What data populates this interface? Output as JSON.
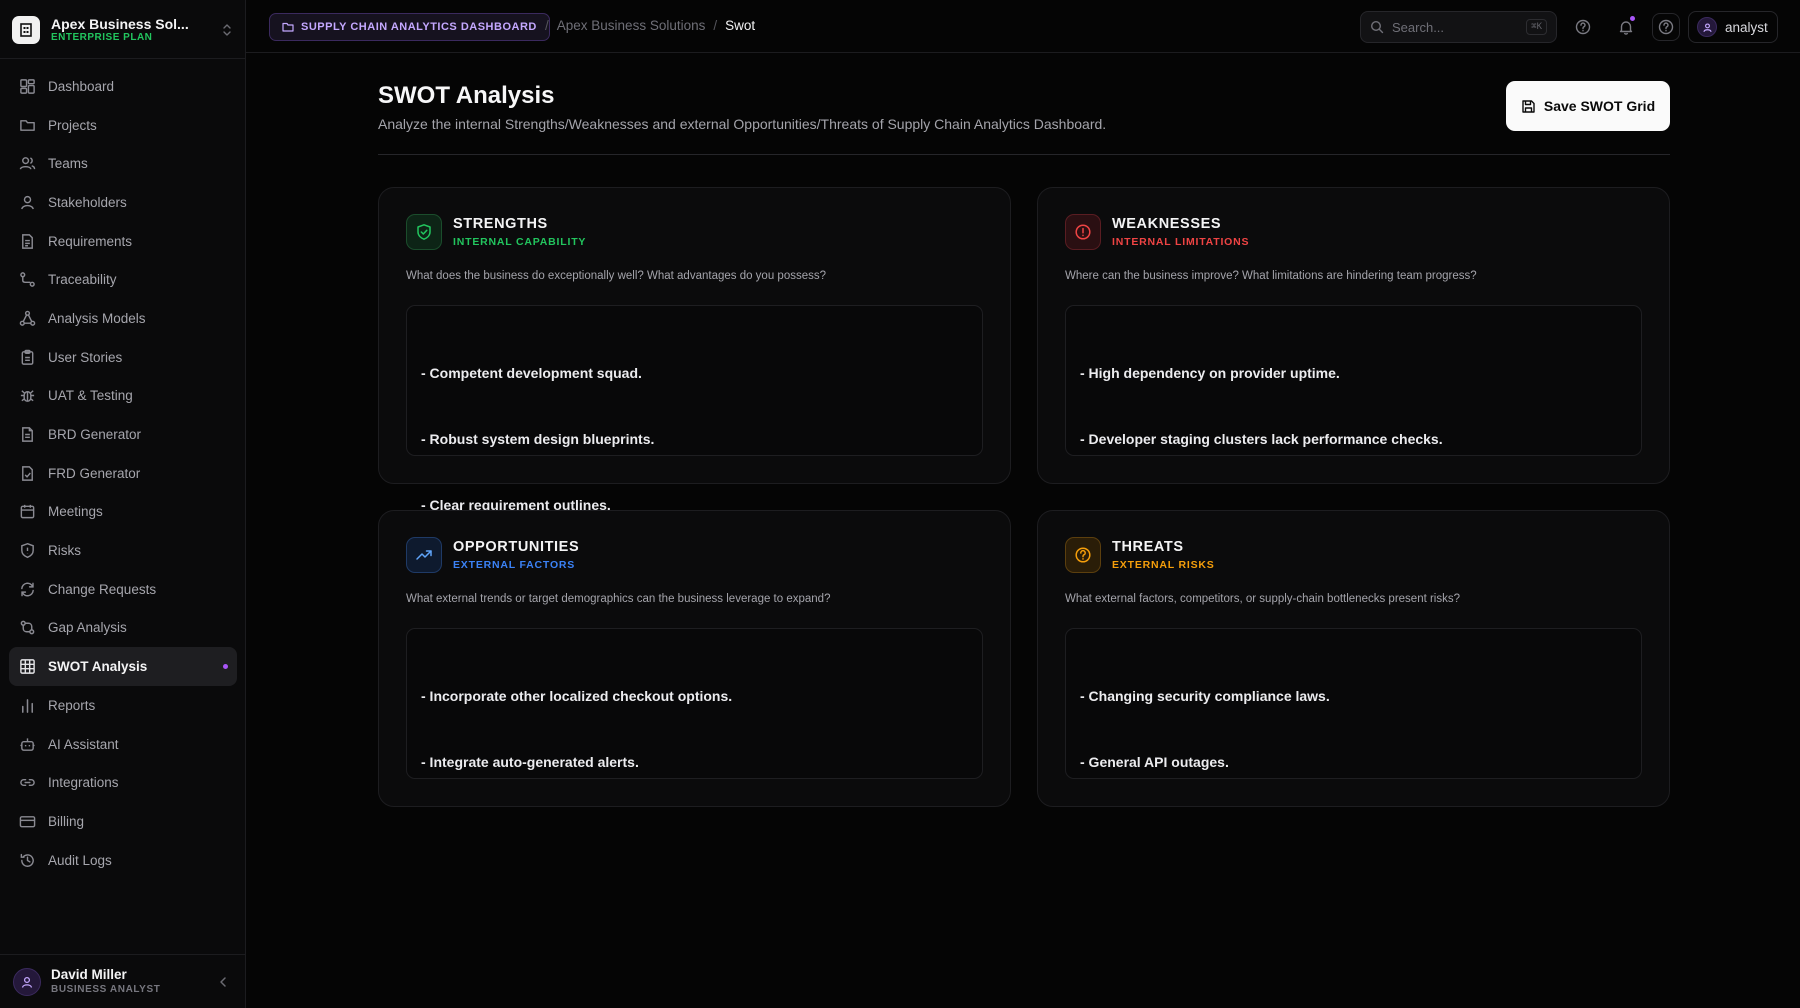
{
  "workspace": {
    "name": "Apex Business Sol...",
    "plan": "ENTERPRISE PLAN"
  },
  "sidebar": {
    "items": [
      {
        "label": "Dashboard",
        "icon": "grid-icon"
      },
      {
        "label": "Projects",
        "icon": "folder-icon"
      },
      {
        "label": "Teams",
        "icon": "users-icon"
      },
      {
        "label": "Stakeholders",
        "icon": "user-icon"
      },
      {
        "label": "Requirements",
        "icon": "file-text-icon"
      },
      {
        "label": "Traceability",
        "icon": "route-icon"
      },
      {
        "label": "Analysis Models",
        "icon": "network-icon"
      },
      {
        "label": "User Stories",
        "icon": "clipboard-icon"
      },
      {
        "label": "UAT & Testing",
        "icon": "bug-icon"
      },
      {
        "label": "BRD Generator",
        "icon": "file-icon"
      },
      {
        "label": "FRD Generator",
        "icon": "file-check-icon"
      },
      {
        "label": "Meetings",
        "icon": "calendar-icon"
      },
      {
        "label": "Risks",
        "icon": "shield-alert-icon"
      },
      {
        "label": "Change Requests",
        "icon": "refresh-icon"
      },
      {
        "label": "Gap Analysis",
        "icon": "git-compare-icon"
      },
      {
        "label": "SWOT Analysis",
        "icon": "table-grid-icon",
        "active": true
      },
      {
        "label": "Reports",
        "icon": "bar-chart-icon"
      },
      {
        "label": "AI Assistant",
        "icon": "bot-icon"
      },
      {
        "label": "Integrations",
        "icon": "link-icon"
      },
      {
        "label": "Billing",
        "icon": "credit-card-icon"
      },
      {
        "label": "Audit Logs",
        "icon": "history-icon"
      }
    ]
  },
  "user": {
    "name": "David Miller",
    "role": "BUSINESS ANALYST"
  },
  "topbar": {
    "project_badge": "SUPPLY CHAIN ANALYTICS DASHBOARD",
    "breadcrumb": {
      "separator": "/",
      "parent": "Apex Business Solutions",
      "current": "Swot"
    },
    "search": {
      "placeholder": "Search...",
      "shortcut": "⌘K"
    },
    "account_name": "analyst"
  },
  "page": {
    "title": "SWOT Analysis",
    "description": "Analyze the internal Strengths/Weaknesses and external Opportunities/Threats of Supply Chain Analytics Dashboard.",
    "save_label": "Save SWOT Grid"
  },
  "quadrants": {
    "strengths": {
      "title": "STRENGTHS",
      "subtitle": "INTERNAL CAPABILITY",
      "question": "What does the business do exceptionally well? What advantages do you possess?",
      "lines": [
        "- Competent development squad.",
        "- Robust system design blueprints.",
        "- Clear requirement outlines."
      ],
      "accent": "#22c55e"
    },
    "weaknesses": {
      "title": "WEAKNESSES",
      "subtitle": "INTERNAL LIMITATIONS",
      "question": "Where can the business improve? What limitations are hindering team progress?",
      "lines": [
        "- High dependency on provider uptime.",
        "- Developer staging clusters lack performance checks."
      ],
      "accent": "#ef4444"
    },
    "opportunities": {
      "title": "OPPORTUNITIES",
      "subtitle": "EXTERNAL FACTORS",
      "question": "What external trends or target demographics can the business leverage to expand?",
      "lines": [
        "- Incorporate other localized checkout options.",
        "- Integrate auto-generated alerts."
      ],
      "accent": "#3b82f6"
    },
    "threats": {
      "title": "THREATS",
      "subtitle": "EXTERNAL RISKS",
      "question": "What external factors, competitors, or supply-chain bottlenecks present risks?",
      "lines": [
        "- Changing security compliance laws.",
        "- General API outages."
      ],
      "accent": "#f59e0b"
    }
  }
}
